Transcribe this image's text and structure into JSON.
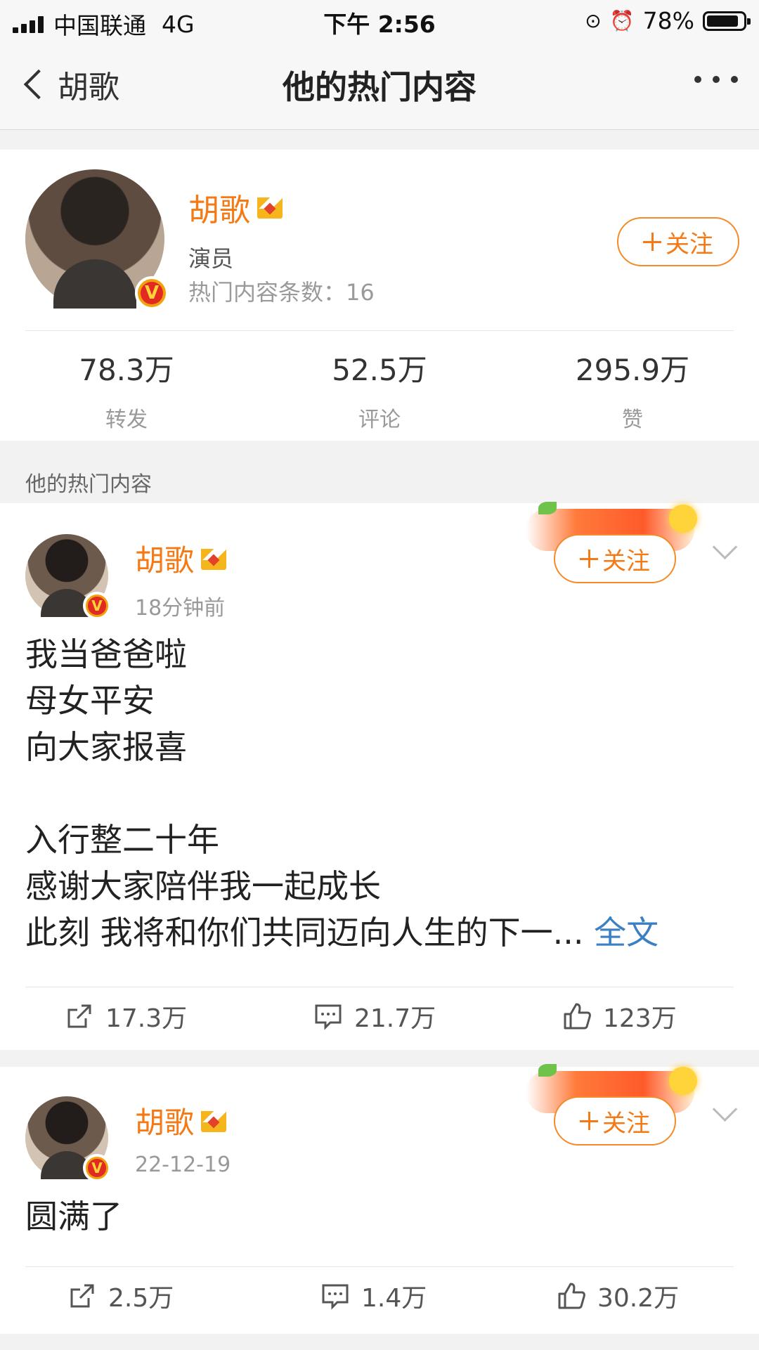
{
  "status_bar": {
    "carrier": "中国联通",
    "network": "4G",
    "time": "下午 2:56",
    "battery": "78%",
    "battery_level": 0.78
  },
  "nav": {
    "back_label": "胡歌",
    "title": "他的热门内容"
  },
  "profile": {
    "name": "胡歌",
    "title": "演员",
    "hot_count_label": "热门内容条数：",
    "hot_count": "16",
    "follow_label": "关注",
    "stats": [
      {
        "value": "78.3万",
        "label": "转发"
      },
      {
        "value": "52.5万",
        "label": "评论"
      },
      {
        "value": "295.9万",
        "label": "赞"
      }
    ]
  },
  "section_label": "他的热门内容",
  "posts": [
    {
      "name": "胡歌",
      "time": "18分钟前",
      "follow_label": "关注",
      "lines": [
        "我当爸爸啦",
        "母女平安",
        "向大家报喜",
        "",
        "入行整二十年",
        "感谢大家陪伴我一起成长",
        "此刻 我将和你们共同迈向人生的下一..."
      ],
      "more_label": "全文",
      "reposts": "17.3万",
      "comments": "21.7万",
      "likes": "123万"
    },
    {
      "name": "胡歌",
      "time": "22-12-19",
      "follow_label": "关注",
      "lines": [
        "圆满了"
      ],
      "reposts": "2.5万",
      "comments": "1.4万",
      "likes": "30.2万"
    }
  ],
  "colors": {
    "accent": "#f57a15",
    "link": "#3c80c4",
    "background": "#f2f2f2"
  },
  "icons": [
    "back-chevron-icon",
    "more-dots-icon",
    "verified-v-icon",
    "crown-icon",
    "plus-icon",
    "dropdown-chevron-icon",
    "repost-icon",
    "comment-icon",
    "like-icon"
  ]
}
